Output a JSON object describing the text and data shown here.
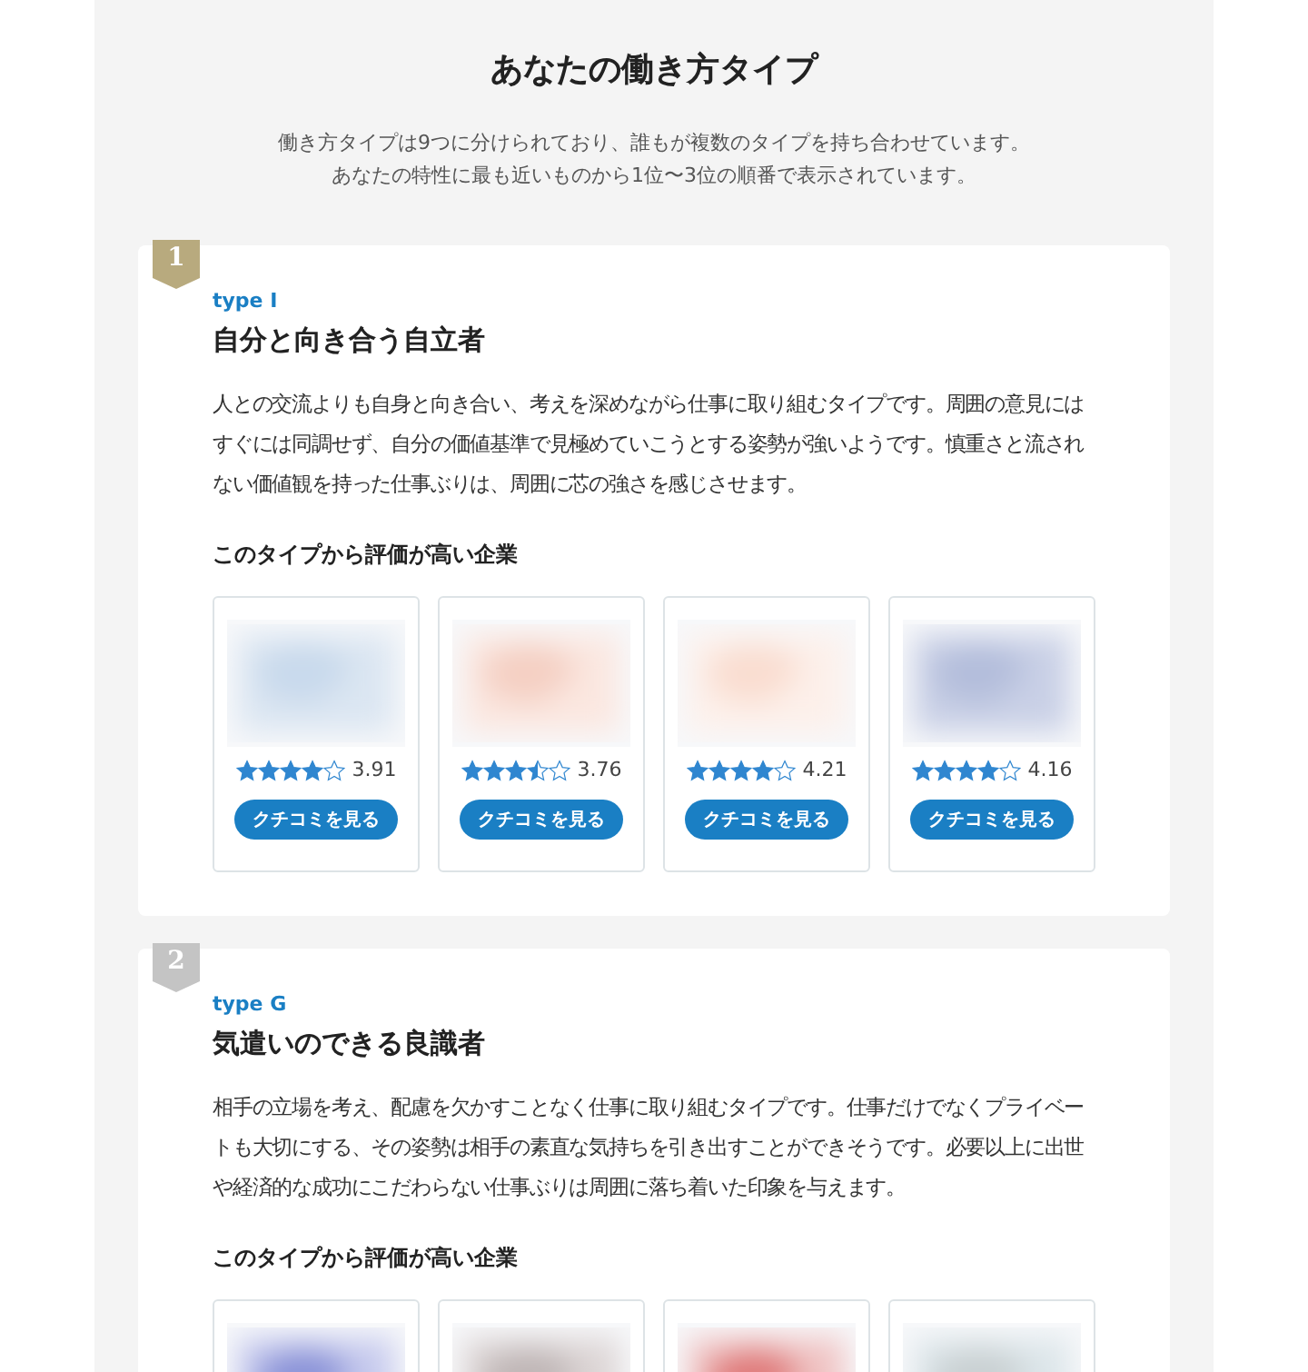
{
  "header": {
    "title": "あなたの働き方タイプ",
    "description_lines": [
      "働き方タイプは9つに分けられており、誰もが複数のタイプを持ち合わせています。",
      "あなたの特性に最も近いものから1位〜3位の順番で表示されています。"
    ]
  },
  "types": [
    {
      "rank": "1",
      "color": "#b8aa7e",
      "code": "type I",
      "name": "自分と向き合う自立者",
      "description": "人との交流よりも自身と向き合い、考えを深めながら仕事に取り組むタイプです。周囲の意見にはすぐには同調せず、自分の価値基準で見極めていこうとする姿勢が強いようです。慎重さと流されない価値観を持った仕事ぶりは、周囲に芯の強さを感じさせます。",
      "companies_heading": "このタイプから評価が高い企業",
      "companies": [
        {
          "kind": "picture",
          "stars": 4,
          "score": "3.91",
          "button": "クチコミを見る"
        },
        {
          "kind": "picture",
          "stars": 3.5,
          "score": "3.76",
          "button": "クチコミを見る"
        },
        {
          "kind": "picture",
          "stars": 4,
          "score": "4.21",
          "button": "クチコミを見る"
        },
        {
          "kind": "picture",
          "stars": 4,
          "score": "4.16",
          "button": "クチコミを見る"
        }
      ]
    },
    {
      "rank": "2",
      "color": "#c4c4c4",
      "code": "type G",
      "name": "気遣いのできる良識者",
      "description": "相手の立場を考え、配慮を欠かすことなく仕事に取り組むタイプです。仕事だけでなくプライベートも大切にする、その姿勢は相手の素直な気持ちを引き出すことができそうです。必要以上に出世や経済的な成功にこだわらない仕事ぶりは周囲に落ち着いた印象を与えます。",
      "companies_heading": "このタイプから評価が高い企業"
    }
  ]
}
